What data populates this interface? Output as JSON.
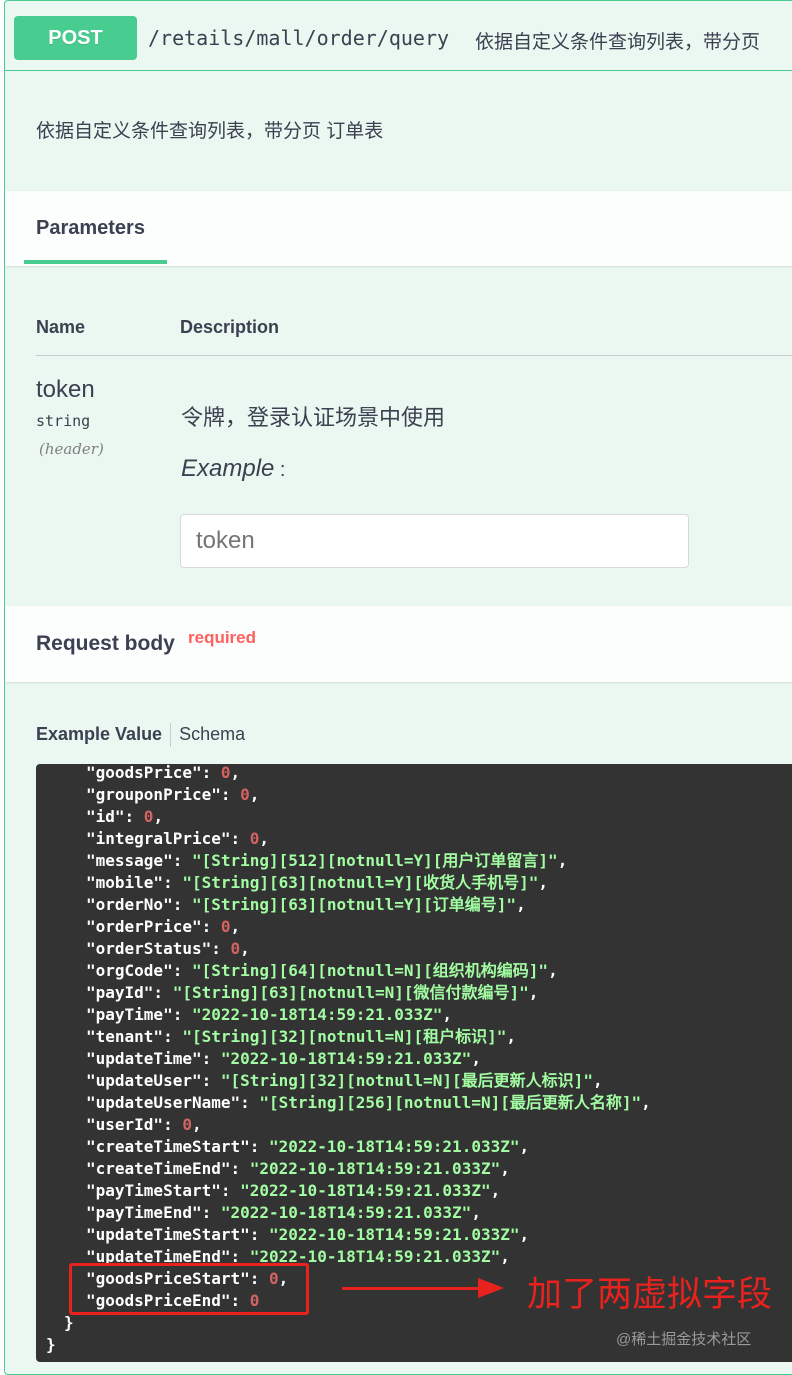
{
  "operation": {
    "method": "POST",
    "path": "/retails/mall/order/query",
    "summary": "依据自定义条件查询列表，带分页",
    "description": "依据自定义条件查询列表，带分页 订单表"
  },
  "colors": {
    "post_green": "#49cc90",
    "post_bg": "#ebf7f1",
    "code_bg": "#333333",
    "annotation_red": "#e8221d"
  },
  "parameters": {
    "tab_label": "Parameters",
    "col_name": "Name",
    "col_description": "Description",
    "items": [
      {
        "name": "token",
        "type": "string",
        "in": "(header)",
        "description": "令牌，登录认证场景中使用",
        "example_label": "Example",
        "example_colon": " :",
        "placeholder": "token"
      }
    ]
  },
  "request_body": {
    "label": "Request body",
    "required": "required",
    "tab_example": "Example Value",
    "tab_schema": "Schema"
  },
  "code_lines": [
    {
      "key": "goodsPrice",
      "val": "0",
      "kind": "n"
    },
    {
      "key": "grouponPrice",
      "val": "0",
      "kind": "n"
    },
    {
      "key": "id",
      "val": "0",
      "kind": "n"
    },
    {
      "key": "integralPrice",
      "val": "0",
      "kind": "n"
    },
    {
      "key": "message",
      "val": "\"[String][512][notnull=Y][用户订单留言]\"",
      "kind": "s"
    },
    {
      "key": "mobile",
      "val": "\"[String][63][notnull=Y][收货人手机号]\"",
      "kind": "s"
    },
    {
      "key": "orderNo",
      "val": "\"[String][63][notnull=Y][订单编号]\"",
      "kind": "s"
    },
    {
      "key": "orderPrice",
      "val": "0",
      "kind": "n"
    },
    {
      "key": "orderStatus",
      "val": "0",
      "kind": "n"
    },
    {
      "key": "orgCode",
      "val": "\"[String][64][notnull=N][组织机构编码]\"",
      "kind": "s"
    },
    {
      "key": "payId",
      "val": "\"[String][63][notnull=N][微信付款编号]\"",
      "kind": "s"
    },
    {
      "key": "payTime",
      "val": "\"2022-10-18T14:59:21.033Z\"",
      "kind": "s"
    },
    {
      "key": "tenant",
      "val": "\"[String][32][notnull=N][租户标识]\"",
      "kind": "s"
    },
    {
      "key": "updateTime",
      "val": "\"2022-10-18T14:59:21.033Z\"",
      "kind": "s"
    },
    {
      "key": "updateUser",
      "val": "\"[String][32][notnull=N][最后更新人标识]\"",
      "kind": "s"
    },
    {
      "key": "updateUserName",
      "val": "\"[String][256][notnull=N][最后更新人名称]\"",
      "kind": "s"
    },
    {
      "key": "userId",
      "val": "0",
      "kind": "n"
    },
    {
      "key": "createTimeStart",
      "val": "\"2022-10-18T14:59:21.033Z\"",
      "kind": "s"
    },
    {
      "key": "createTimeEnd",
      "val": "\"2022-10-18T14:59:21.033Z\"",
      "kind": "s"
    },
    {
      "key": "payTimeStart",
      "val": "\"2022-10-18T14:59:21.033Z\"",
      "kind": "s"
    },
    {
      "key": "payTimeEnd",
      "val": "\"2022-10-18T14:59:21.033Z\"",
      "kind": "s"
    },
    {
      "key": "updateTimeStart",
      "val": "\"2022-10-18T14:59:21.033Z\"",
      "kind": "s"
    },
    {
      "key": "updateTimeEnd",
      "val": "\"2022-10-18T14:59:21.033Z\"",
      "kind": "s"
    },
    {
      "key": "goodsPriceStart",
      "val": "0",
      "kind": "n"
    },
    {
      "key": "goodsPriceEnd",
      "val": "0",
      "kind": "n",
      "last": true
    }
  ],
  "code_close_inner": "}",
  "code_close_outer": "}",
  "annotation": "加了两虚拟字段",
  "watermark": "@稀土掘金技术社区"
}
